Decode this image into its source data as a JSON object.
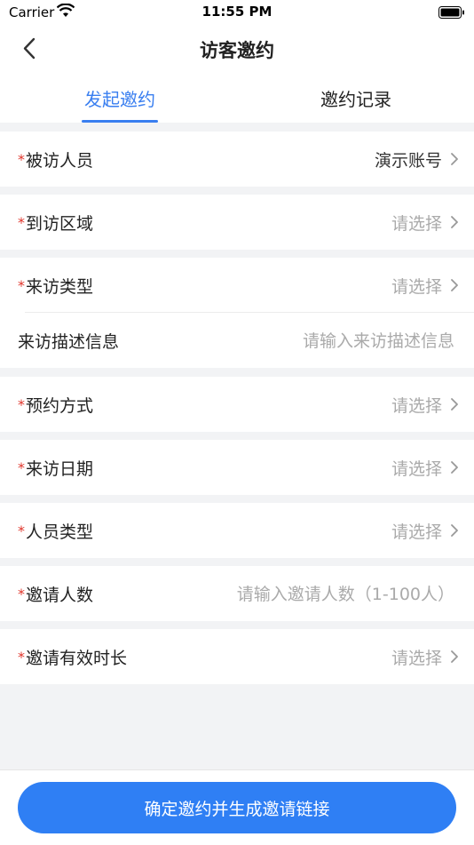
{
  "status_bar": {
    "carrier": "Carrier",
    "time": "11:55 PM"
  },
  "nav": {
    "title": "访客邀约"
  },
  "tabs": [
    {
      "label": "发起邀约",
      "active": true
    },
    {
      "label": "邀约记录",
      "active": false
    }
  ],
  "required_mark": "*",
  "form": {
    "visitee": {
      "label": "被访人员",
      "value": "演示账号"
    },
    "area": {
      "label": "到访区域",
      "value": "请选择"
    },
    "visit_type": {
      "label": "来访类型",
      "value": "请选择"
    },
    "description": {
      "label": "来访描述信息",
      "placeholder": "请输入来访描述信息"
    },
    "booking_method": {
      "label": "预约方式",
      "value": "请选择"
    },
    "visit_date": {
      "label": "来访日期",
      "value": "请选择"
    },
    "person_type": {
      "label": "人员类型",
      "value": "请选择"
    },
    "invite_count": {
      "label": "邀请人数",
      "placeholder": "请输入邀请人数（1-100人）"
    },
    "valid_duration": {
      "label": "邀请有效时长",
      "value": "请选择"
    }
  },
  "submit_label": "确定邀约并生成邀请链接",
  "colors": {
    "accent": "#2f7ff4",
    "required": "#e0352b",
    "background": "#f2f3f5"
  }
}
